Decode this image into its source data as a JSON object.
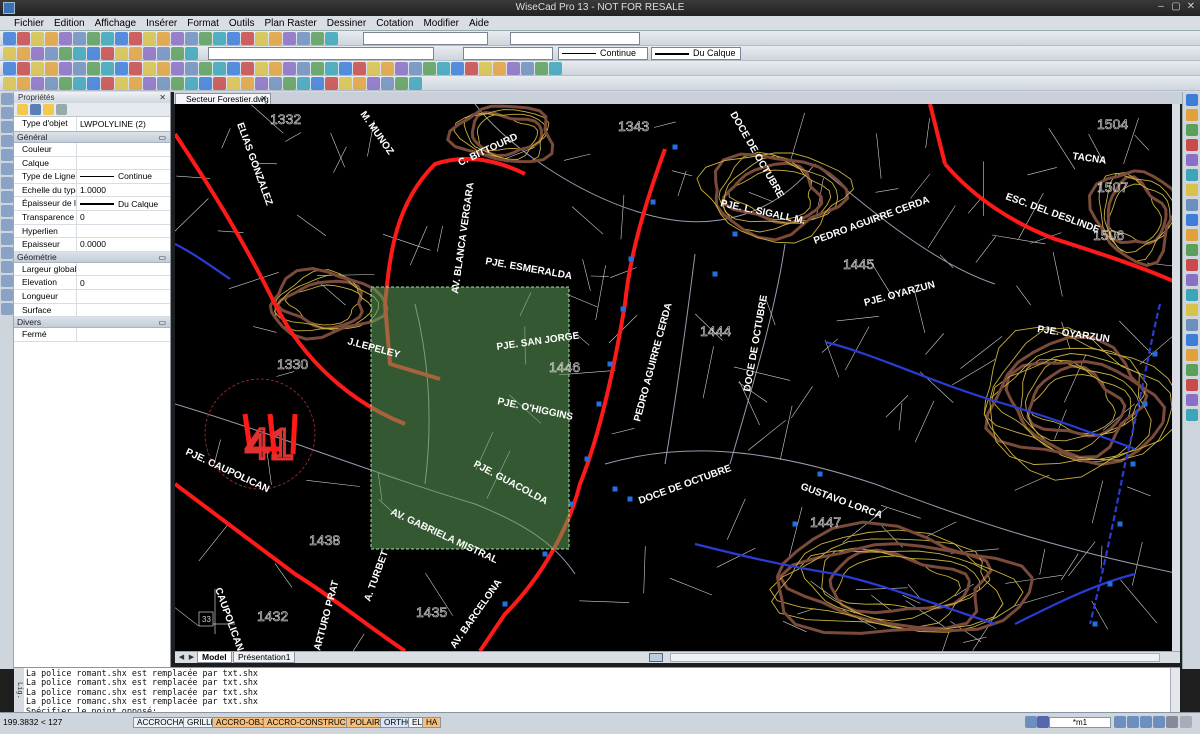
{
  "window": {
    "title": "WiseCad Pro 13 - NOT FOR RESALE"
  },
  "menu": [
    "Fichier",
    "Edition",
    "Affichage",
    "Insérer",
    "Format",
    "Outils",
    "Plan Raster",
    "Dessiner",
    "Cotation",
    "Modifier",
    "Aide"
  ],
  "toolbar": {
    "linetype": "Continue",
    "lineweight": "Du Calque"
  },
  "properties": {
    "title": "Propriétés",
    "object_type_label": "Type d'objet",
    "object_type": "LWPOLYLINE (2)",
    "sections": [
      {
        "name": "Général",
        "rows": [
          {
            "label": "Couleur",
            "value": ""
          },
          {
            "label": "Calque",
            "value": ""
          },
          {
            "label": "Type de Ligne",
            "value": "Continue",
            "line": "thin"
          },
          {
            "label": "Echelle du type ...",
            "value": "1.0000"
          },
          {
            "label": "Épaisseur de ligne",
            "value": "Du Calque",
            "line": "thick"
          },
          {
            "label": "Transparence",
            "value": "0"
          },
          {
            "label": "Hyperlien",
            "value": ""
          },
          {
            "label": "Epaisseur",
            "value": "0.0000"
          }
        ]
      },
      {
        "name": "Géométrie",
        "rows": [
          {
            "label": "Largeur globale",
            "value": ""
          },
          {
            "label": "Elevation",
            "value": "0"
          },
          {
            "label": "Longueur",
            "value": ""
          },
          {
            "label": "Surface",
            "value": ""
          }
        ]
      },
      {
        "name": "Divers",
        "rows": [
          {
            "label": "Fermé",
            "value": ""
          }
        ]
      }
    ]
  },
  "document": {
    "tab": "Secteur Forestier.dwg"
  },
  "drawing": {
    "streets": [
      "C. BITTOURD",
      "ELIAS GONZALEZ",
      "M. MUNOZ",
      "AV. BLANCA VERGARA",
      "PJE. ESMERALDA",
      "PJE. SAN JORGE",
      "PJE. O'HIGGINS",
      "PJE. GUACOLDA",
      "AV. GABRIELA MISTRAL",
      "J.LEPELEY",
      "PJE. CAUPOLICAN",
      "PEDRO AGUIRRE CERDA",
      "DOCE DE OCTUBRE",
      "PJE. L. SIGALL M.",
      "PEDRO AGUIRRE CERDA",
      "PJE. OYARZUN",
      "PJE. OYARZUN",
      "ESC. DEL DESLINDE",
      "TACNA",
      "GUSTAVO LORCA",
      "DOCE DE OCTUBRE",
      "DOCE DE OCTUBRE",
      "AV. BARCELONA",
      "CAUPOLICAN",
      "ARTURO PRAT",
      "A. TURBET"
    ],
    "block_numbers": [
      "1332",
      "1330",
      "1343",
      "1444",
      "1445",
      "1446",
      "1447",
      "1438",
      "1435",
      "1507",
      "1506",
      "1504",
      "1432",
      "41",
      "33"
    ]
  },
  "layouts": [
    "Model",
    "Présentation1"
  ],
  "command": {
    "history": [
      "La police romant.shx est remplacée par txt.shx",
      "La police romant.shx est remplacée par txt.shx",
      "La police romanc.shx est remplacée par txt.shx",
      "La police romanc.shx est remplacée par txt.shx",
      "Spécifier le point opposé:"
    ]
  },
  "status": {
    "coords": "199.3832 < 127",
    "toggles": [
      "ACCROCHAGE",
      "GRILLE",
      "ACCRO-OBJET",
      "ACCRO-CONSTRUCTION",
      "POLAIRE",
      "ORTHO",
      "EL",
      "HA"
    ],
    "scale": "*m1"
  },
  "colors": {
    "contour": "#c9b13c",
    "road": "#ff1a1a",
    "parcel": "#d8d8d8",
    "selection": "#5fa05a",
    "stream": "#2a3cd6"
  }
}
